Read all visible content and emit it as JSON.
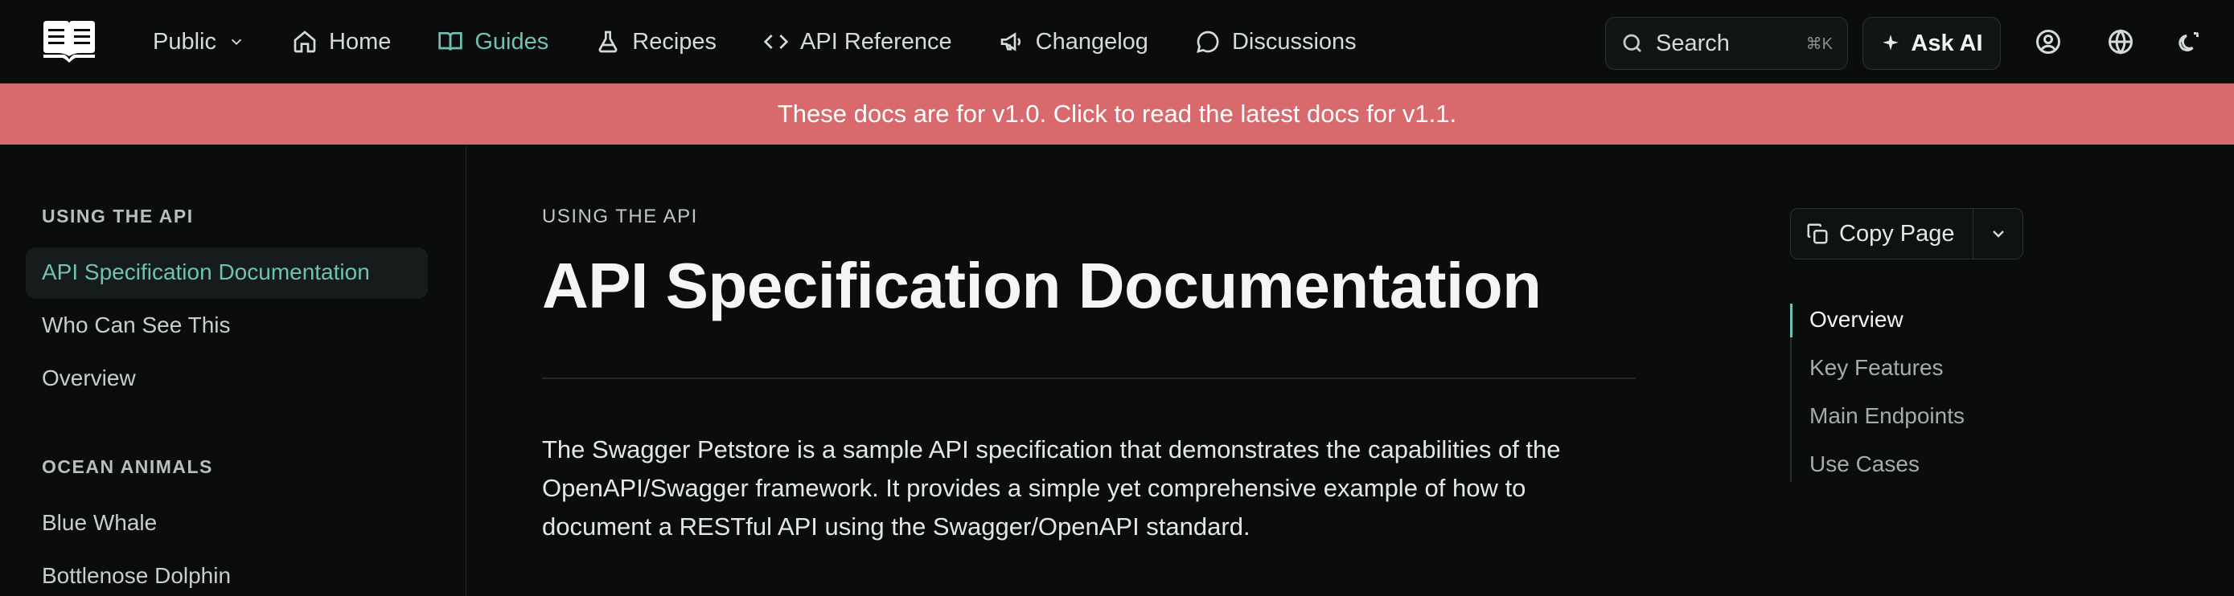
{
  "nav": {
    "items": [
      {
        "label": "Public",
        "icon": "chevron-down-icon"
      },
      {
        "label": "Home",
        "icon": "home-icon"
      },
      {
        "label": "Guides",
        "icon": "book-icon"
      },
      {
        "label": "Recipes",
        "icon": "flask-icon"
      },
      {
        "label": "API Reference",
        "icon": "code-icon"
      },
      {
        "label": "Changelog",
        "icon": "megaphone-icon"
      },
      {
        "label": "Discussions",
        "icon": "chat-bubble-icon"
      }
    ],
    "active": "Guides"
  },
  "search": {
    "label": "Search",
    "shortcut": "⌘K"
  },
  "ask_ai": {
    "label": "Ask AI"
  },
  "banner": {
    "text": "These docs are for v1.0. Click to read the latest docs for v1.1."
  },
  "sidebar": {
    "sections": [
      {
        "title": "USING THE API",
        "items": [
          "API Specification Documentation",
          "Who Can See This",
          "Overview"
        ]
      },
      {
        "title": "OCEAN ANIMALS",
        "items": [
          "Blue Whale",
          "Bottlenose Dolphin"
        ]
      }
    ],
    "active_item": "API Specification Documentation"
  },
  "page": {
    "eyebrow": "USING THE API",
    "title": "API Specification Documentation",
    "intro": "The Swagger Petstore is a sample API specification that demonstrates the capabilities of the OpenAPI/Swagger framework. It provides a simple yet comprehensive example of how to document a RESTful API using the Swagger/OpenAPI standard."
  },
  "copy_page": {
    "label": "Copy Page"
  },
  "toc": {
    "items": [
      "Overview",
      "Key Features",
      "Main Endpoints",
      "Use Cases"
    ],
    "active": "Overview"
  },
  "colors": {
    "accent": "#6fc2b2",
    "banner": "#d86a6d",
    "background": "#0b0d0d"
  }
}
